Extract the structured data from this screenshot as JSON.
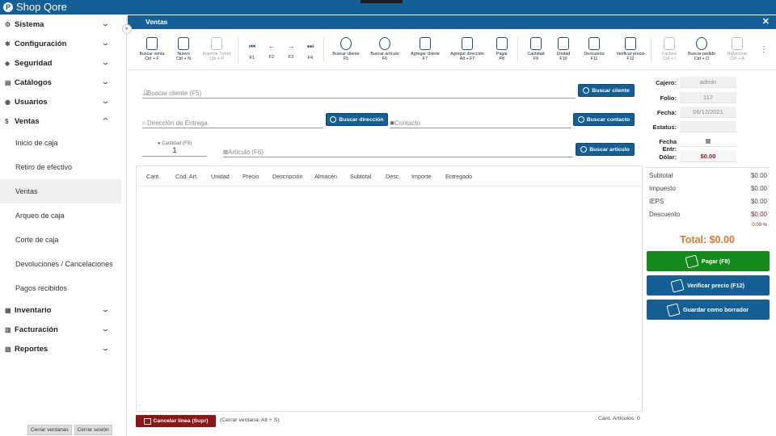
{
  "app": {
    "title": "Shop Qore"
  },
  "sidebar": {
    "sections_top": [
      {
        "label": "Sistema",
        "icon": "gear-icon"
      },
      {
        "label": "Configuración",
        "icon": "cog-icon"
      },
      {
        "label": "Seguridad",
        "icon": "shield-icon"
      },
      {
        "label": "Catálogos",
        "icon": "book-icon"
      },
      {
        "label": "Usuarios",
        "icon": "user-icon"
      },
      {
        "label": "Ventas",
        "icon": "dollar-icon"
      }
    ],
    "ventas_items": [
      "Inicio de caja",
      "Retiro de efectivo",
      "Ventas",
      "Arqueo de caja",
      "Corte de caja",
      "Devoluciones / Cancelaciones",
      "Pagos recibidos"
    ],
    "sections_bottom": [
      {
        "label": "Inventario",
        "icon": "box-icon"
      },
      {
        "label": "Facturación",
        "icon": "invoice-icon"
      },
      {
        "label": "Reportes",
        "icon": "report-icon"
      }
    ],
    "footer": {
      "close_windows": "Cerrar ventanas",
      "logout": "Cerrar sesión"
    }
  },
  "window": {
    "title": "Ventas"
  },
  "toolbar": {
    "buttons": [
      {
        "l1": "Buscar venta",
        "l2": "Ctrl + F"
      },
      {
        "l1": "Nuevo",
        "l2": "Ctrl + N"
      },
      {
        "l1": "Imprimir Ticket",
        "l2": "Ctrl + P"
      },
      {
        "l1": "Buscar cliente",
        "l2": "F5"
      },
      {
        "l1": "Buscar artículo",
        "l2": "F6"
      },
      {
        "l1": "Agregar cliente",
        "l2": "F7"
      },
      {
        "l1": "Agregar dirección",
        "l2": "Alt + F7"
      },
      {
        "l1": "Pagar",
        "l2": "F8"
      },
      {
        "l1": "Cantidad",
        "l2": "F9"
      },
      {
        "l1": "Unidad",
        "l2": "F10"
      },
      {
        "l1": "Descuento",
        "l2": "F11"
      },
      {
        "l1": "Verificar precio",
        "l2": "F12"
      },
      {
        "l1": "Factura",
        "l2": "Ctrl + I"
      },
      {
        "l1": "Buscar pedido",
        "l2": "Ctrl + O"
      },
      {
        "l1": "Refacturar",
        "l2": "Ctrl + A"
      }
    ],
    "nav": [
      "F1",
      "F2",
      "F3",
      "F4"
    ]
  },
  "form": {
    "cliente_placeholder": "Buscar cliente (F5)",
    "buscar_cliente": "Buscar cliente",
    "direccion_placeholder": "Dirección de Entrega",
    "buscar_direccion": "Buscar dirección",
    "contacto_placeholder": "Contacto",
    "buscar_contacto": "Buscar contacto",
    "cantidad_label": "Cantidad (F9)",
    "cantidad_value": "1",
    "articulo_placeholder": "Artículo (F6)",
    "buscar_articulo": "Buscar artículo"
  },
  "grid": {
    "columns": [
      "Cant.",
      "Cod. Art.",
      "Unidad",
      "Precio",
      "Descripción",
      "Almacén",
      "Subtotal",
      "Desc.",
      "Importe",
      "Entregado"
    ]
  },
  "info": {
    "cajero_label": "Cajero:",
    "cajero": "admin",
    "folio_label": "Folio:",
    "folio": "117",
    "fecha_label": "Fecha:",
    "fecha": "06/12/2021",
    "estatus_label": "Estatus:",
    "estatus": "",
    "fecha_entr_label": "Fecha Entr:",
    "dolar_label": "Dólar:",
    "dolar": "$0.00"
  },
  "summary": {
    "subtotal_label": "Subtotal",
    "subtotal": "$0.00",
    "impuesto_label": "Impuesto",
    "impuesto": "$0.00",
    "ieps_label": "IEPS",
    "ieps": "$0.00",
    "descuento_label": "Descuento",
    "descuento": "$0.00",
    "descuento_pct": "0.00 %",
    "total": "Total: $0.00"
  },
  "actions": {
    "pagar": "Pagar (F8)",
    "verificar": "Verificar precio (F12)",
    "borrador": "Guardar como borrador"
  },
  "footer": {
    "cancel": "Cancelar línea (Supr)",
    "close_hint": "(Cerrar ventana: Alt + S)",
    "count": "Cant. Artículos: 0"
  },
  "colors": {
    "primary": "#135f96",
    "success": "#138a1a",
    "danger": "#8f1418",
    "total": "#e0772b"
  }
}
